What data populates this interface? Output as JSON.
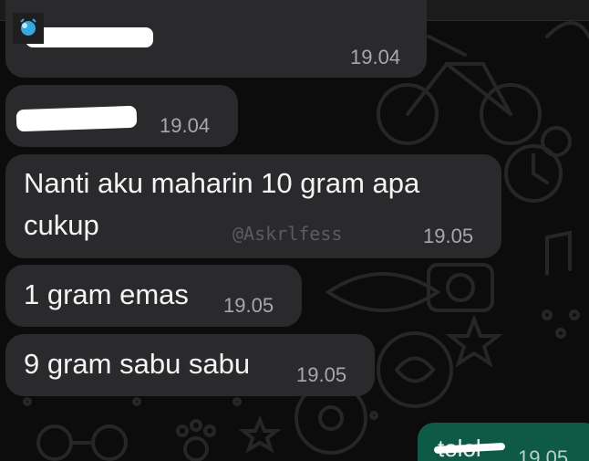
{
  "chat": {
    "messages": [
      {
        "text": "",
        "time": "19.04"
      },
      {
        "text": "",
        "time": "19.04"
      },
      {
        "text_line1": "Nanti aku maharin 10 gram apa",
        "text_line2": "cukup",
        "time": "19.05"
      },
      {
        "text": "1 gram emas",
        "time": "19.05"
      },
      {
        "text": "9 gram sabu sabu",
        "time": "19.05"
      }
    ],
    "watermark": "@Askrlfess",
    "outgoing": {
      "text": "tolol",
      "time": "19.05"
    }
  },
  "colors": {
    "background": "#0c0c0c",
    "incoming_bubble": "#2a2a2c",
    "outgoing_bubble": "#0f5a46",
    "timestamp": "#a8a8ab"
  },
  "icons": {
    "corner": "app-icon",
    "wallpaper": "doodle-pattern"
  }
}
